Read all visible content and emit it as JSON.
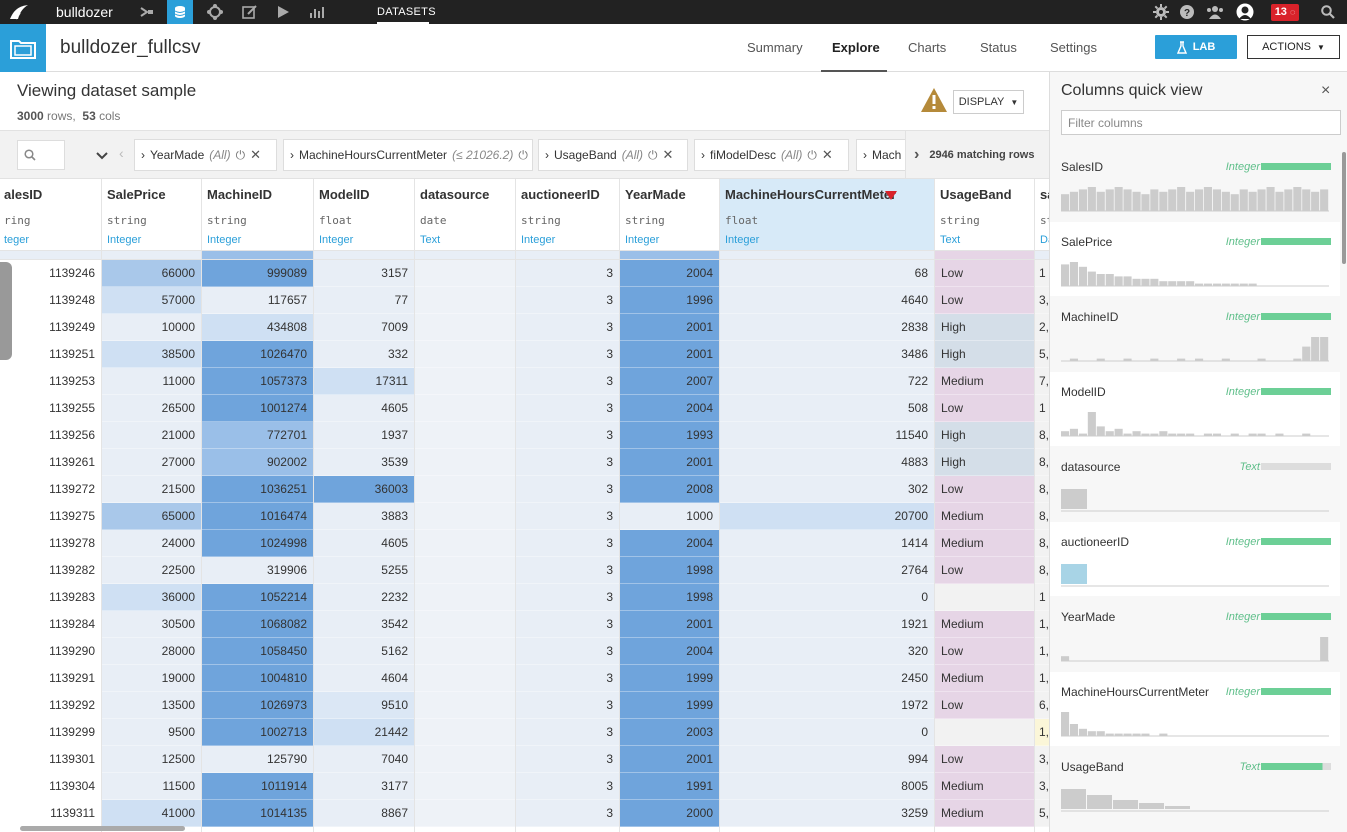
{
  "topnav": {
    "project_name": "bulldozer",
    "datasets_label": "DATASETS",
    "notification_count": "13"
  },
  "header": {
    "dataset_name": "bulldozer_fullcsv",
    "tabs": [
      "Summary",
      "Explore",
      "Charts",
      "Status",
      "Settings"
    ],
    "active_tab": "Explore",
    "lab_label": "LAB",
    "actions_label": "ACTIONS"
  },
  "view": {
    "title": "Viewing dataset sample",
    "rows_count": "3000",
    "rows_word": "rows,",
    "cols_count": "53",
    "cols_word": "cols",
    "display_label": "DISPLAY"
  },
  "filters": {
    "chips": [
      {
        "name": "YearMade",
        "value": "(All)"
      },
      {
        "name": "MachineHoursCurrentMeter",
        "value": "(≤ 21026.2)"
      },
      {
        "name": "UsageBand",
        "value": "(All)"
      },
      {
        "name": "fiModelDesc",
        "value": "(All)"
      },
      {
        "name": "Mach",
        "value": ""
      }
    ],
    "matching_rows": "2946 matching rows"
  },
  "columns": [
    {
      "name": "alesID",
      "storage": "ring",
      "meaning": "teger"
    },
    {
      "name": "SalePrice",
      "storage": "string",
      "meaning": "Integer"
    },
    {
      "name": "MachineID",
      "storage": "string",
      "meaning": "Integer"
    },
    {
      "name": "ModelID",
      "storage": "float",
      "meaning": "Integer"
    },
    {
      "name": "datasource",
      "storage": "date",
      "meaning": "Text"
    },
    {
      "name": "auctioneerID",
      "storage": "string",
      "meaning": "Integer"
    },
    {
      "name": "YearMade",
      "storage": "string",
      "meaning": "Integer"
    },
    {
      "name": "MachineHoursCurrentMeter",
      "storage": "float",
      "meaning": "Integer"
    },
    {
      "name": "UsageBand",
      "storage": "string",
      "meaning": "Text"
    },
    {
      "name": "sa",
      "storage": "st",
      "meaning": "Da"
    }
  ],
  "rows": [
    [
      "1139246",
      "66000",
      "999089",
      "3157",
      "",
      "3",
      "2004",
      "68",
      "Low",
      "1"
    ],
    [
      "1139248",
      "57000",
      "117657",
      "77",
      "",
      "3",
      "1996",
      "4640",
      "Low",
      "3,"
    ],
    [
      "1139249",
      "10000",
      "434808",
      "7009",
      "",
      "3",
      "2001",
      "2838",
      "High",
      "2,"
    ],
    [
      "1139251",
      "38500",
      "1026470",
      "332",
      "",
      "3",
      "2001",
      "3486",
      "High",
      "5,"
    ],
    [
      "1139253",
      "11000",
      "1057373",
      "17311",
      "",
      "3",
      "2007",
      "722",
      "Medium",
      "7,"
    ],
    [
      "1139255",
      "26500",
      "1001274",
      "4605",
      "",
      "3",
      "2004",
      "508",
      "Low",
      "1"
    ],
    [
      "1139256",
      "21000",
      "772701",
      "1937",
      "",
      "3",
      "1993",
      "11540",
      "High",
      "8,"
    ],
    [
      "1139261",
      "27000",
      "902002",
      "3539",
      "",
      "3",
      "2001",
      "4883",
      "High",
      "8,"
    ],
    [
      "1139272",
      "21500",
      "1036251",
      "36003",
      "",
      "3",
      "2008",
      "302",
      "Low",
      "8,"
    ],
    [
      "1139275",
      "65000",
      "1016474",
      "3883",
      "",
      "3",
      "1000",
      "20700",
      "Medium",
      "8,"
    ],
    [
      "1139278",
      "24000",
      "1024998",
      "4605",
      "",
      "3",
      "2004",
      "1414",
      "Medium",
      "8,"
    ],
    [
      "1139282",
      "22500",
      "319906",
      "5255",
      "",
      "3",
      "1998",
      "2764",
      "Low",
      "8,"
    ],
    [
      "1139283",
      "36000",
      "1052214",
      "2232",
      "",
      "3",
      "1998",
      "0",
      "",
      "1"
    ],
    [
      "1139284",
      "30500",
      "1068082",
      "3542",
      "",
      "3",
      "2001",
      "1921",
      "Medium",
      "1,"
    ],
    [
      "1139290",
      "28000",
      "1058450",
      "5162",
      "",
      "3",
      "2004",
      "320",
      "Low",
      "1,"
    ],
    [
      "1139291",
      "19000",
      "1004810",
      "4604",
      "",
      "3",
      "1999",
      "2450",
      "Medium",
      "1,"
    ],
    [
      "1139292",
      "13500",
      "1026973",
      "9510",
      "",
      "3",
      "1999",
      "1972",
      "Low",
      "6,"
    ],
    [
      "1139299",
      "9500",
      "1002713",
      "21442",
      "",
      "3",
      "2003",
      "0",
      "",
      "1,"
    ],
    [
      "1139301",
      "12500",
      "125790",
      "7040",
      "",
      "3",
      "2001",
      "994",
      "Low",
      "3,"
    ],
    [
      "1139304",
      "11500",
      "1011914",
      "3177",
      "",
      "3",
      "1991",
      "8005",
      "Medium",
      "3,"
    ],
    [
      "1139311",
      "41000",
      "1014135",
      "8867",
      "",
      "3",
      "2000",
      "3259",
      "Medium",
      "5,"
    ]
  ],
  "quickview": {
    "title": "Columns quick view",
    "close_label": "×",
    "filter_placeholder": "Filter columns",
    "items": [
      {
        "name": "SalesID",
        "type": "Integer"
      },
      {
        "name": "SalePrice",
        "type": "Integer"
      },
      {
        "name": "MachineID",
        "type": "Integer"
      },
      {
        "name": "ModelID",
        "type": "Integer"
      },
      {
        "name": "datasource",
        "type": "Text"
      },
      {
        "name": "auctioneerID",
        "type": "Integer"
      },
      {
        "name": "YearMade",
        "type": "Integer"
      },
      {
        "name": "MachineHoursCurrentMeter",
        "type": "Integer"
      },
      {
        "name": "UsageBand",
        "type": "Text"
      }
    ]
  },
  "colors": {
    "accent": "#2b9fd9",
    "topbar": "#222222",
    "valid_bar": "#6ccf96",
    "heat_dark": "#6fa4dc",
    "heat_light": "#e8eef6",
    "low_band": "#e6d5e6",
    "high_band": "#d4dee8",
    "filter_red": "#d9222a"
  }
}
